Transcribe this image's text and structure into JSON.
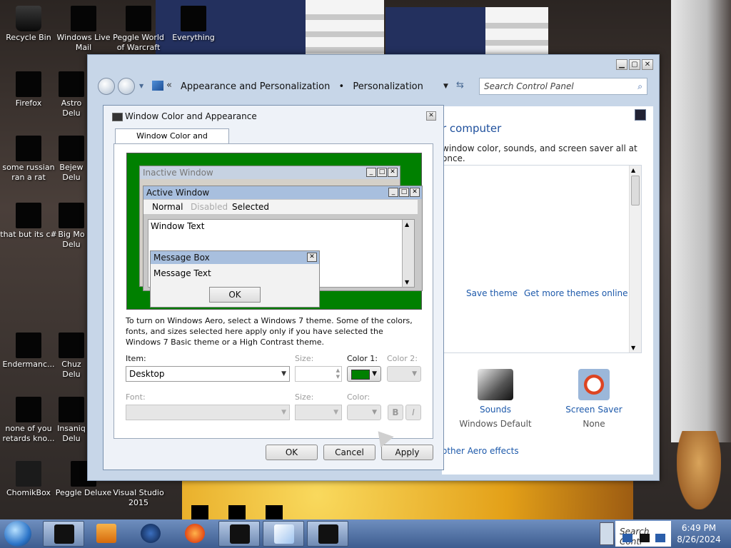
{
  "desktop": {
    "icons": [
      {
        "label": "Recycle Bin"
      },
      {
        "label": "Windows Live Mail"
      },
      {
        "label": "Peggle World of Warcraft"
      },
      {
        "label": "Everything"
      },
      {
        "label": "Firefox"
      },
      {
        "label": "Astro Delu"
      },
      {
        "label": "some russian ran a rat"
      },
      {
        "label": "Bejew Delu"
      },
      {
        "label": "that but its c#"
      },
      {
        "label": "Big Mo Delu"
      },
      {
        "label": "Endermanc..."
      },
      {
        "label": "Chuz Delu"
      },
      {
        "label": "none of you retards kno..."
      },
      {
        "label": "Insaniq Delu"
      },
      {
        "label": "ChomikBox"
      },
      {
        "label": "Peggle Deluxe"
      },
      {
        "label": "Visual Studio 2015"
      }
    ]
  },
  "control_panel": {
    "breadcrumb": [
      "Appearance and Personalization",
      "Personalization"
    ],
    "breadcrumb_prefix": "«",
    "breadcrumb_sep": "•",
    "search_placeholder": "Search Control Panel",
    "heading": "r computer",
    "subheading": "window color, sounds, and screen saver all at once.",
    "save_theme": "Save theme",
    "get_more_themes": "Get more themes online",
    "sounds_label": "Sounds",
    "sounds_value": "Windows Default",
    "screensaver_label": "Screen Saver",
    "screensaver_value": "None",
    "aero_link": "other Aero effects"
  },
  "dialog": {
    "title": "Window Color and Appearance",
    "tab": "Window Color and Appearance",
    "preview": {
      "inactive_title": "Inactive Window",
      "active_title": "Active Window",
      "menu_normal": "Normal",
      "menu_disabled": "Disabled",
      "menu_selected": "Selected",
      "window_text": "Window Text",
      "msgbox_title": "Message Box",
      "msgbox_text": "Message Text",
      "msgbox_ok": "OK"
    },
    "info_text": "To turn on Windows Aero, select a Windows 7 theme.  Some of the colors, fonts, and sizes selected here apply only if you have selected the Windows 7 Basic theme or a High Contrast theme.",
    "item_label": "Item:",
    "item_value": "Desktop",
    "size_label": "Size:",
    "color1_label": "Color 1:",
    "color2_label": "Color 2:",
    "color1_value": "#008000",
    "font_label": "Font:",
    "font_size_label": "Size:",
    "font_color_label": "Color:",
    "bold_label": "B",
    "italic_label": "I",
    "ok": "OK",
    "cancel": "Cancel",
    "apply": "Apply"
  },
  "clock": {
    "time": "6:49 PM",
    "date": "8/26/2024"
  },
  "tray": {
    "search_text": "Search Contr"
  }
}
